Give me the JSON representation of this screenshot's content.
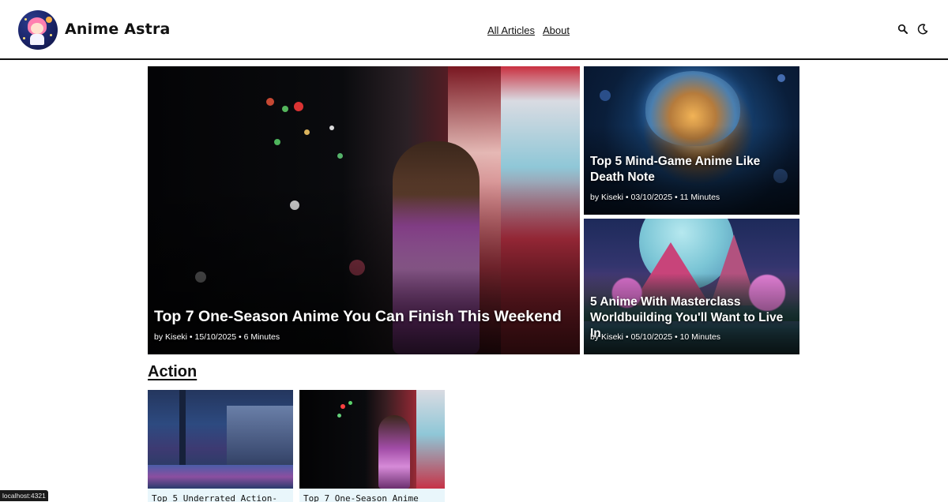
{
  "header": {
    "site_title": "Anime Astra",
    "logo_icon": "astronaut-girl-logo-icon",
    "nav": [
      {
        "label": "All Articles"
      },
      {
        "label": "About"
      }
    ],
    "icons": [
      "search-icon",
      "moon-icon"
    ]
  },
  "hero": [
    {
      "title": "Top 7 One-Season Anime You Can Finish This Weekend",
      "meta": "by Kiseki • 15/10/2025 • 6 Minutes"
    },
    {
      "title": "Top 5 Mind-Game Anime Like Death Note",
      "meta": "by Kiseki • 03/10/2025 • 11 Minutes"
    },
    {
      "title": "5 Anime With Masterclass Worldbuilding You'll Want to Live In",
      "meta": "by Kiseki • 05/10/2025 • 10 Minutes"
    }
  ],
  "section": {
    "title": "Action",
    "articles": [
      {
        "title": "Top 5 Underrated Action-"
      },
      {
        "title": "Top 7 One-Season Anime"
      }
    ]
  },
  "status_bar": {
    "text": "localhost:4321"
  }
}
